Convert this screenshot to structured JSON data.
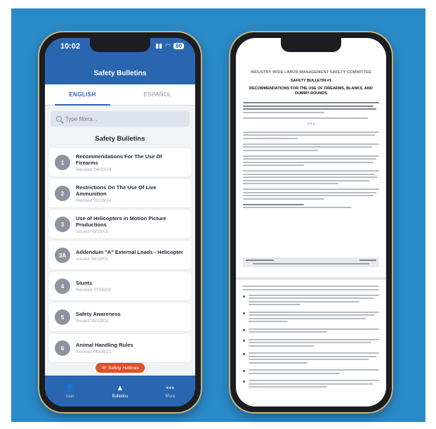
{
  "colors": {
    "background": "#2a8ac8",
    "app_header": "#2a66b0",
    "pill": "#e2501f",
    "phone_frame": "#c9b27a"
  },
  "left_phone": {
    "status": {
      "time": "10:02",
      "battery": "80"
    },
    "title": "Safety Bulletins",
    "tabs": [
      {
        "label": "ENGLISH",
        "active": true
      },
      {
        "label": "ESPAÑOL",
        "active": false
      }
    ],
    "search": {
      "placeholder": "Type filters..."
    },
    "list_title": "Safety Bulletins",
    "bulletins": [
      {
        "number": "1",
        "title": "Recommendations For The Use Of Firearms",
        "subtitle": "Revised 04/20/24"
      },
      {
        "number": "2",
        "title": "Restrictions On The Use Of Live Ammunition",
        "subtitle": "Revised 02/29/24"
      },
      {
        "number": "3",
        "title": "Use of Helicopters in Motion Picture Productions",
        "subtitle": "Issued 08/19/01"
      },
      {
        "number": "3A",
        "title": "Addendum \"A\" External Loads - Helicopter",
        "subtitle": "Issued 08/19/01"
      },
      {
        "number": "4",
        "title": "Stunts",
        "subtitle": "Revised 07/08/02"
      },
      {
        "number": "5",
        "title": "Safety Awareness",
        "subtitle": "Issued 08/19/01"
      },
      {
        "number": "6",
        "title": "Animal Handling Rules",
        "subtitle": "Revised 06/08/21"
      }
    ],
    "pill_label": "Safety Hotlines",
    "nav": [
      {
        "label": "User",
        "icon": "user-icon",
        "active": false
      },
      {
        "label": "Bulletins",
        "icon": "cone-icon",
        "active": true
      },
      {
        "label": "More",
        "icon": "more-icon",
        "active": false
      }
    ]
  },
  "right_phone": {
    "doc_header": "INDUSTRY WIDE LABOR-MANAGEMENT SAFETY COMMITTEE",
    "doc_subheader": "SAFETY BULLETIN #1",
    "doc_title": "RECOMMENDATIONS FOR THE USE OF FIREARMS, BLANKS, AND DUMMY ROUNDS",
    "doc_stars": "* * *"
  }
}
